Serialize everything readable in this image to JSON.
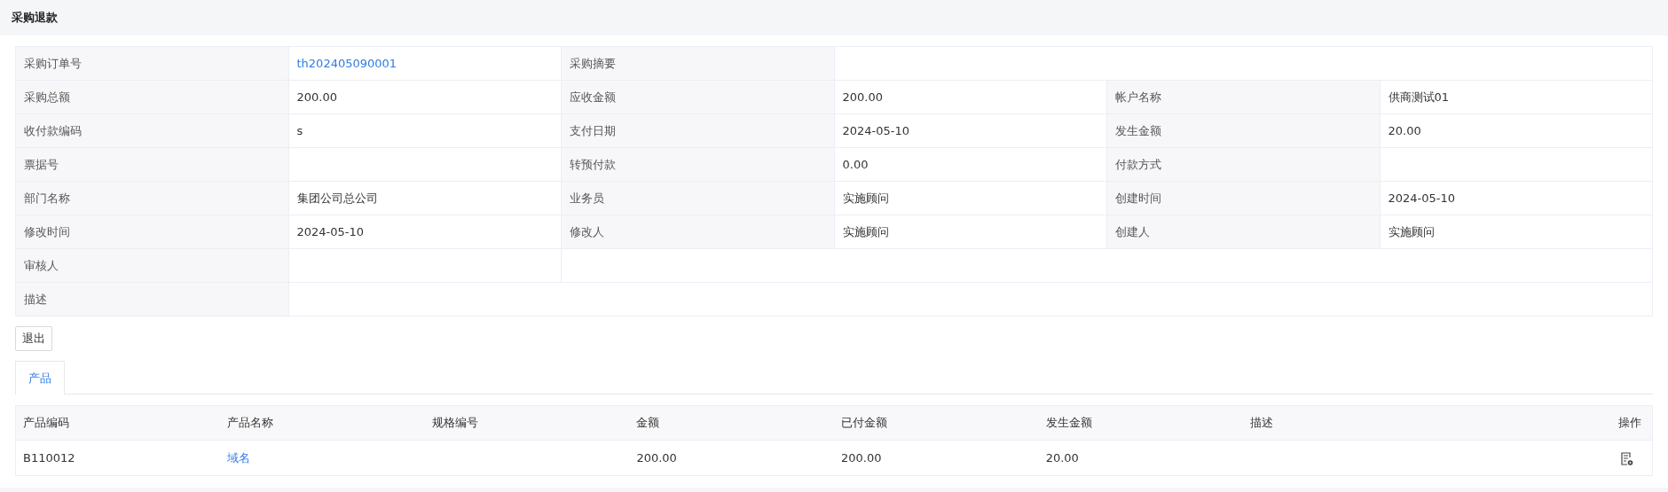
{
  "page_title": "采购退款",
  "detail_rows": [
    {
      "fields": [
        {
          "label": "采购订单号",
          "value": "th202405090001",
          "kind": "link"
        },
        {
          "label": "采购摘要",
          "kind": "wide"
        }
      ]
    },
    {
      "fields": [
        {
          "label": "采购总额",
          "value": "200.00",
          "kind": "text"
        },
        {
          "label": "应收金额",
          "value": "200.00",
          "kind": "text"
        },
        {
          "label": "帐户名称",
          "value": "供商测试01",
          "kind": "text"
        }
      ]
    },
    {
      "fields": [
        {
          "label": "收付款编码",
          "value": "s",
          "kind": "text"
        },
        {
          "label": "支付日期",
          "value": "2024-05-10",
          "kind": "text"
        },
        {
          "label": "发生金额",
          "value": "20.00",
          "kind": "text"
        }
      ]
    },
    {
      "fields": [
        {
          "label": "票据号",
          "kind": "text"
        },
        {
          "label": "转预付款",
          "value": "0.00",
          "kind": "text"
        },
        {
          "label": "付款方式",
          "kind": "text"
        }
      ]
    },
    {
      "fields": [
        {
          "label": "部门名称",
          "value": "集团公司总公司",
          "kind": "text"
        },
        {
          "label": "业务员",
          "value": "实施顾问",
          "kind": "text"
        },
        {
          "label": "创建时间",
          "value": "2024-05-10",
          "kind": "text"
        }
      ]
    },
    {
      "fields": [
        {
          "label": "修改时间",
          "value": "2024-05-10",
          "kind": "text"
        },
        {
          "label": "修改人",
          "value": "实施顾问",
          "kind": "text"
        },
        {
          "label": "创建人",
          "value": "实施顾问",
          "kind": "text"
        }
      ]
    },
    {
      "fields": [
        {
          "label": "审核人",
          "kind": "text"
        }
      ]
    },
    {
      "fields": [
        {
          "label": "描述",
          "kind": "wide"
        }
      ]
    }
  ],
  "buttons": [
    "退出"
  ],
  "tabs": [
    {
      "label": "产品",
      "selected": true
    }
  ],
  "product_table": {
    "columns": [
      {
        "label": "产品编码",
        "kind": "text"
      },
      {
        "label": "产品名称",
        "kind": "link"
      },
      {
        "label": "规格编号",
        "kind": "text"
      },
      {
        "label": "金额",
        "kind": "text"
      },
      {
        "label": "已付金额",
        "kind": "text"
      },
      {
        "label": "发生金额",
        "kind": "text"
      },
      {
        "label": "描述",
        "kind": "text"
      },
      {
        "label": "操作",
        "kind": "action"
      }
    ],
    "rows": [
      {
        "cells": [
          "B110012",
          "域名",
          null,
          "200.00",
          "200.00",
          "20.00",
          null,
          null
        ]
      }
    ]
  }
}
